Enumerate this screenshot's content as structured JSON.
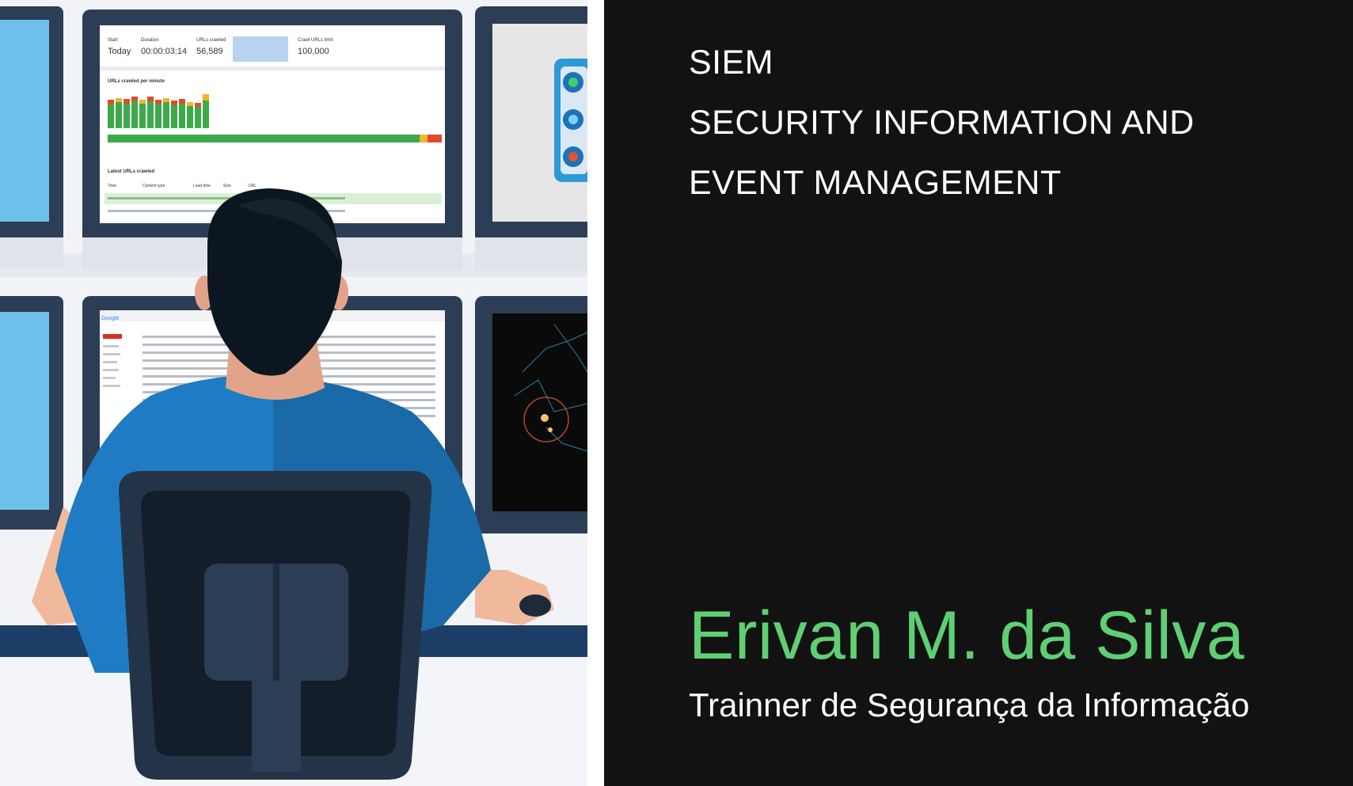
{
  "slide": {
    "title_lines": [
      "SIEM",
      "SECURITY INFORMATION AND",
      "EVENT MANAGEMENT"
    ],
    "author": "Erivan M. da Silva",
    "role": "Trainner de Segurança da Informação"
  },
  "dashboard": {
    "stat_start_label": "Start",
    "stat_start_value": "Today",
    "stat_duration_label": "Duration",
    "stat_duration_value": "00:00:03:14",
    "stat_urls_label": "URLs crawled",
    "stat_urls_value": "56,589",
    "stat_limit_label": "Crawl URLs limit",
    "stat_limit_value": "100,000",
    "chart_title": "URLs crawled per minute",
    "table_title": "Latest URLs crawled",
    "table_headers": [
      "Time",
      "Content type",
      "Load time",
      "Size",
      "URL"
    ]
  },
  "email_screen": {
    "logo_text": "Google"
  },
  "colors": {
    "panel_bg": "#121212",
    "author_green": "#5fcf74",
    "title_white": "#ffffff",
    "shirt_blue": "#1f7cc4",
    "monitor_frame": "#2c3e55"
  }
}
